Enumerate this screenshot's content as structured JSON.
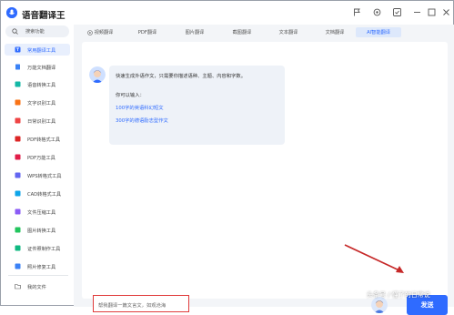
{
  "app": {
    "title": "语音翻译王"
  },
  "titlebar": {
    "icons": [
      "flag-icon",
      "settings-icon",
      "square-check-icon",
      "minimize-icon",
      "maximize-icon",
      "close-icon"
    ]
  },
  "sidebar": {
    "search_label": "搜索功能",
    "items": [
      {
        "label": "常用翻译工具",
        "icon": "translate-icon",
        "active": true
      },
      {
        "label": "万能文档翻译",
        "icon": "doc-translate-icon"
      },
      {
        "label": "语音转换工具",
        "icon": "voice-icon"
      },
      {
        "label": "文字识别工具",
        "icon": "text-recognize-icon"
      },
      {
        "label": "日常识别工具",
        "icon": "scan-icon"
      },
      {
        "label": "PDF转格式工具",
        "icon": "pdf-icon"
      },
      {
        "label": "PDF万能工具",
        "icon": "pdf-tools-icon"
      },
      {
        "label": "WPS转格式工具",
        "icon": "wps-icon"
      },
      {
        "label": "CAD转格式工具",
        "icon": "cad-icon"
      },
      {
        "label": "文件压缩工具",
        "icon": "compress-icon"
      },
      {
        "label": "图片转换工具",
        "icon": "image-convert-icon"
      },
      {
        "label": "证件照制作工具",
        "icon": "id-photo-icon"
      },
      {
        "label": "照片修复工具",
        "icon": "photo-repair-icon"
      }
    ],
    "my_files": "我的文件"
  },
  "tabs": [
    {
      "label": "视频翻译"
    },
    {
      "label": "PDF翻译"
    },
    {
      "label": "图片翻译"
    },
    {
      "label": "截图翻译"
    },
    {
      "label": "文本翻译"
    },
    {
      "label": "文档翻译"
    },
    {
      "label": "AI智能翻译",
      "active": true
    }
  ],
  "chat": {
    "intro": "快速生成外语作文，只需要你描述语种、主题、内容和字数。",
    "can_input": "你可以输入：",
    "examples": [
      "100字的英语科幻短文",
      "300字的德语励志型作文"
    ]
  },
  "input": {
    "text": "帮我翻译一篇文言文，如观沧海"
  },
  "send_button": {
    "label": "发送"
  },
  "watermark": "头条号 / 懂了的日常说",
  "colors": {
    "accent": "#2f6bff",
    "highlight_border": "#e03b3b",
    "arrow": "#c62828"
  }
}
